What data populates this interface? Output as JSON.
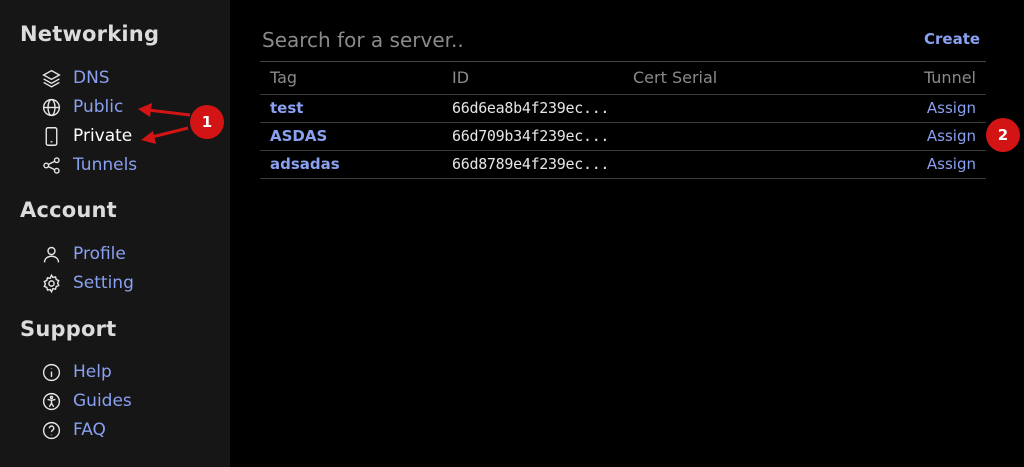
{
  "sidebar": {
    "sections": [
      {
        "title": "Networking"
      },
      {
        "title": "Account"
      },
      {
        "title": "Support"
      }
    ],
    "items": [
      {
        "label": "DNS",
        "icon": "layers-icon"
      },
      {
        "label": "Public",
        "icon": "globe-icon"
      },
      {
        "label": "Private",
        "icon": "phone-icon"
      },
      {
        "label": "Tunnels",
        "icon": "share-icon"
      },
      {
        "label": "Profile",
        "icon": "user-icon"
      },
      {
        "label": "Setting",
        "icon": "gear-icon"
      },
      {
        "label": "Help",
        "icon": "info-icon"
      },
      {
        "label": "Guides",
        "icon": "accessibility-icon"
      },
      {
        "label": "FAQ",
        "icon": "question-icon"
      }
    ]
  },
  "main": {
    "search": {
      "placeholder": "Search for a server..",
      "value": ""
    },
    "create_label": "Create",
    "table": {
      "headers": [
        "Tag",
        "ID",
        "Cert Serial",
        "Tunnel"
      ],
      "rows": [
        {
          "tag": "test",
          "id": "66d6ea8b4f239ec...",
          "cert_serial": "",
          "tunnel": "Assign"
        },
        {
          "tag": "ASDAS",
          "id": "66d709b34f239ec...",
          "cert_serial": "",
          "tunnel": "Assign"
        },
        {
          "tag": "adsadas",
          "id": "66d8789e4f239ec...",
          "cert_serial": "",
          "tunnel": "Assign"
        }
      ]
    }
  },
  "annotations": {
    "badges": [
      "1",
      "2"
    ],
    "color": "#d31414"
  },
  "colors": {
    "accent": "#8aa0f0",
    "sidebar_bg": "#161616",
    "main_bg": "#000000"
  }
}
